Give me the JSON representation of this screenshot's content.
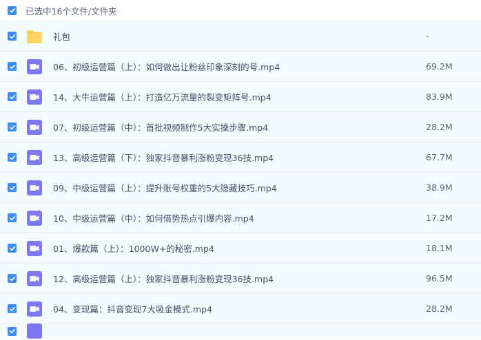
{
  "header": {
    "selection_text": "已选中16个文件/文件夹"
  },
  "colors": {
    "accent": "#3b8cff",
    "video_icon": "#7b78f0",
    "folder": "#ffc94a",
    "row_bg": "#f4fbff"
  },
  "files": [
    {
      "name": "礼包",
      "size": "-",
      "type": "folder"
    },
    {
      "name": "06、初级运营篇（上）：如何做出让粉丝印象深刻的号.mp4",
      "size": "69.2M",
      "type": "video"
    },
    {
      "name": "14、大牛运营篇（上）：打造亿万流量的裂变矩阵号.mp4",
      "size": "83.9M",
      "type": "video"
    },
    {
      "name": "07、初级运营篇（中）：首批视频制作5大实操步骤.mp4",
      "size": "28.2M",
      "type": "video"
    },
    {
      "name": "13、高级运营篇（下）：独家抖音暴利涨粉变现36技.mp4",
      "size": "67.7M",
      "type": "video"
    },
    {
      "name": "09、中级运营篇（上）：提升账号权重的5大隐藏技巧.mp4",
      "size": "38.9M",
      "type": "video"
    },
    {
      "name": "10、中级运营篇（中）：如何借势热点引爆内容.mp4",
      "size": "17.2M",
      "type": "video"
    },
    {
      "name": "01、爆款篇（上）：1000W+的秘密.mp4",
      "size": "18.1M",
      "type": "video"
    },
    {
      "name": "12、高级运营篇（上）：独家抖音暴利涨粉变现36技.mp4",
      "size": "96.5M",
      "type": "video"
    },
    {
      "name": "04、变现篇：抖音变现7大吸金模式.mp4",
      "size": "28.2M",
      "type": "video"
    }
  ]
}
